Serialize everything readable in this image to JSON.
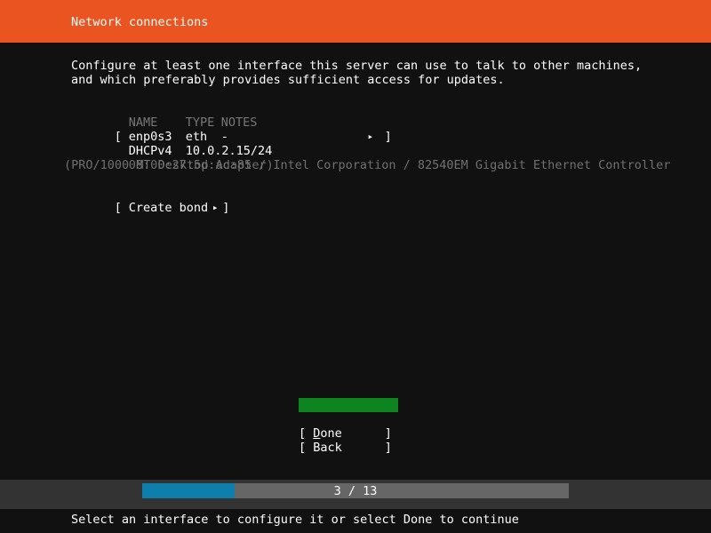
{
  "header": {
    "title": "Network connections",
    "bg_color": "#e95420"
  },
  "main": {
    "intro_line1": "Configure at least one interface this server can use to talk to other machines,",
    "intro_line2": "and which preferably provides sufficient access for updates.",
    "table": {
      "headers": {
        "name": "NAME",
        "type": "TYPE",
        "notes": "NOTES"
      },
      "rows": [
        {
          "bracket_open": "[ ",
          "name": "enp0s3",
          "type": "eth",
          "notes": "-",
          "arrow": "▸",
          "bracket_close": "]",
          "detail_label": "DHCPv4",
          "detail_value": "10.0.2.15/24",
          "description_line1": "08:00:27:5d:ac:85 / Intel Corporation / 82540EM Gigabit Ethernet Controller",
          "description_line2": "(PRO/1000 MT Desktop Adapter)"
        }
      ]
    },
    "create_bond": {
      "bracket_open": "[ ",
      "label": "Create bond",
      "arrow": "▸",
      "bracket_close": "]"
    }
  },
  "buttons": {
    "done": {
      "bracket_open": "[ ",
      "accel": "D",
      "rest": "one",
      "pad": "                                        ",
      "bracket_close": "]",
      "highlight_color": "#0e8420",
      "selected": true
    },
    "back": {
      "bracket_open": "[ ",
      "label": "Back",
      "pad": "                                        ",
      "bracket_close": "]",
      "selected": false
    }
  },
  "progress": {
    "current": 3,
    "total": 13,
    "label": "3 / 13",
    "fill_color": "#0e7fad",
    "track_color": "#666666",
    "band_color": "#333333"
  },
  "footer": {
    "hint": "Select an interface to configure it or select Done to continue"
  }
}
